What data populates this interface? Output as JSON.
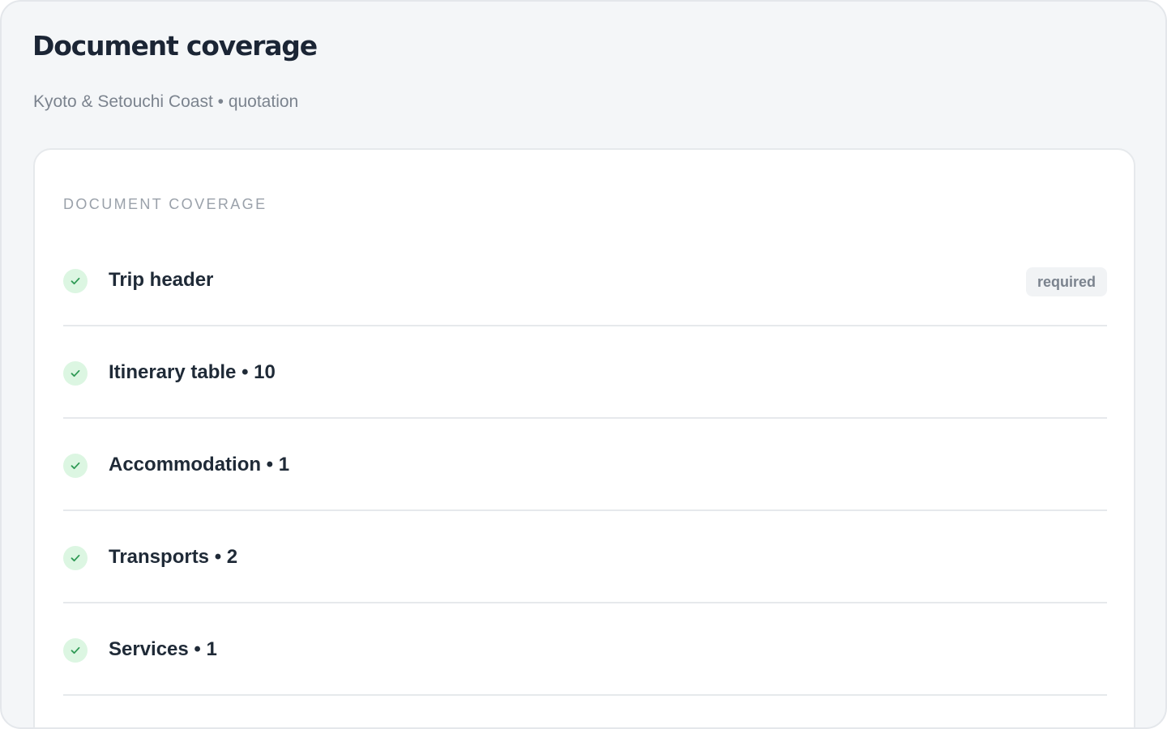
{
  "header": {
    "title": "Document coverage",
    "subtitle": "Kyoto & Setouchi Coast • quotation"
  },
  "card": {
    "section_label": "DOCUMENT COVERAGE",
    "rows": [
      {
        "label": "Trip header",
        "status": "complete",
        "badge": "required"
      },
      {
        "label": "Itinerary table • 10",
        "status": "complete"
      },
      {
        "label": "Accommodation • 1",
        "status": "complete"
      },
      {
        "label": "Transports • 2",
        "status": "complete"
      },
      {
        "label": "Services • 1",
        "status": "complete"
      }
    ]
  },
  "icons": {
    "row_status": "check-circle-icon"
  },
  "colors": {
    "title": "#1b2535",
    "check_bg": "#dcf6e2",
    "check_stroke": "#2f9a55",
    "badge_bg": "#f1f3f5"
  }
}
